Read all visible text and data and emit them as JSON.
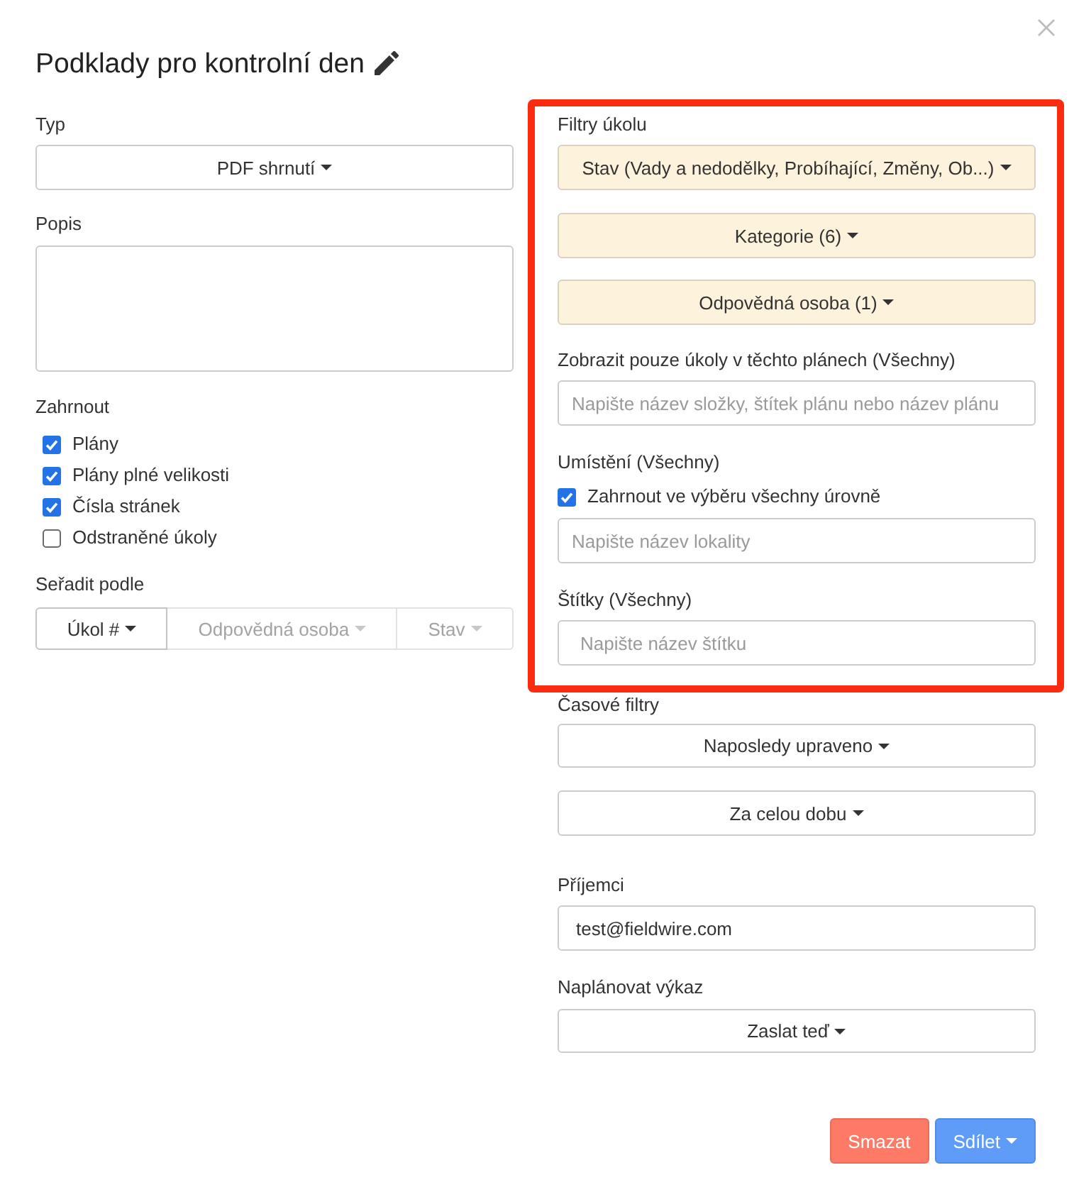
{
  "dialog": {
    "title": "Podklady pro kontrolní den"
  },
  "left": {
    "type": {
      "label": "Typ",
      "value": "PDF shrnutí"
    },
    "description": {
      "label": "Popis"
    },
    "include": {
      "label": "Zahrnout",
      "options": [
        {
          "label": "Plány",
          "checked": true
        },
        {
          "label": "Plány plné velikosti",
          "checked": true
        },
        {
          "label": "Čísla stránek",
          "checked": true
        },
        {
          "label": "Odstraněné úkoly",
          "checked": false
        }
      ]
    },
    "sort": {
      "label": "Seřadit podle",
      "options": [
        {
          "label": "Úkol #",
          "selected": true
        },
        {
          "label": "Odpovědná osoba",
          "selected": false
        },
        {
          "label": "Stav",
          "selected": false
        }
      ]
    }
  },
  "task_filters": {
    "label": "Filtry úkolu",
    "highlighted": true,
    "dropdowns": [
      {
        "label": "Stav (Vady a nedodělky, Probíhající, Změny, Ob...)",
        "active": true
      },
      {
        "label": "Kategorie (6)",
        "active": true
      },
      {
        "label": "Odpovědná osoba (1)",
        "active": true
      }
    ],
    "plans": {
      "label": "Zobrazit pouze úkoly v těchto plánech (Všechny)",
      "placeholder": "Napište název složky, štítek plánu nebo název plánu"
    },
    "location": {
      "label": "Umístění (Všechny)",
      "include_all_levels": {
        "label": "Zahrnout ve výběru všechny úrovně",
        "checked": true
      },
      "placeholder": "Napište název lokality"
    },
    "tags": {
      "label": "Štítky (Všechny)",
      "placeholder": "Napište název štítku"
    }
  },
  "time_filters": {
    "label": "Časové filtry",
    "dropdowns": [
      {
        "label": "Naposledy upraveno",
        "active": false
      },
      {
        "label": "Za celou dobu",
        "active": false
      }
    ]
  },
  "recipients": {
    "label": "Příjemci",
    "value": "test@fieldwire.com"
  },
  "schedule": {
    "label": "Naplánovat výkaz",
    "value": "Zaslat teď"
  },
  "actions": [
    {
      "label": "Smazat",
      "kind": "danger",
      "dropdown": false
    },
    {
      "label": "Sdílet",
      "kind": "primary",
      "dropdown": true
    }
  ]
}
